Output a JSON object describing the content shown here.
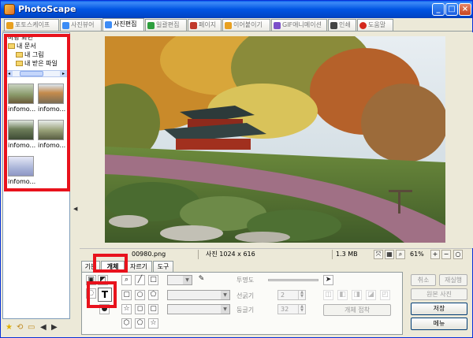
{
  "app": {
    "title": "PhotoScape"
  },
  "tabs": [
    {
      "label": "포토스케이프",
      "icon": "#e8a020"
    },
    {
      "label": "사진뷰어",
      "icon": "#3c8cf6"
    },
    {
      "label": "사진편집",
      "icon": "#3c8cf6"
    },
    {
      "label": "일괄편집",
      "icon": "#2e9f3e"
    },
    {
      "label": "페이지",
      "icon": "#c0392b"
    },
    {
      "label": "이어붙이기",
      "icon": "#e8a020"
    },
    {
      "label": "GIF애니메이션",
      "icon": "#7b4fc9"
    },
    {
      "label": "인쇄",
      "icon": "#444444"
    },
    {
      "label": "도움말",
      "icon": "#d4281c"
    }
  ],
  "active_tab": "사진편집",
  "tree": {
    "items": [
      "바탕 화면",
      "내 문서",
      "내 그림",
      "내 받은 파일"
    ]
  },
  "thumbnails": [
    {
      "label": "infomo...",
      "color": "#8a9a6a"
    },
    {
      "label": "infomo...",
      "color": "#b79a6e"
    },
    {
      "label": "infomo...",
      "color": "#6e7f5a"
    },
    {
      "label": "infomo...",
      "color": "#9aa37a"
    },
    {
      "label": "infomo...",
      "color": "#a9b4d8"
    }
  ],
  "status": {
    "filename": "00980.png",
    "photo_size": "사진 1024 x 616",
    "file_size": "1.3 MB",
    "zoom": "61%"
  },
  "subtabs": [
    "기본",
    "개체",
    "자르기",
    "도구"
  ],
  "object_panel": {
    "opacity_label": "투명도",
    "line_width_label": "선굵기",
    "line_width_value": "2",
    "rounding_label": "둥글기",
    "rounding_value": "32",
    "attach_label": "개체 접착"
  },
  "actions": {
    "cancel": "취소",
    "redo": "재실행",
    "original": "원본 사진",
    "save": "저장",
    "menu": "메뉴"
  }
}
